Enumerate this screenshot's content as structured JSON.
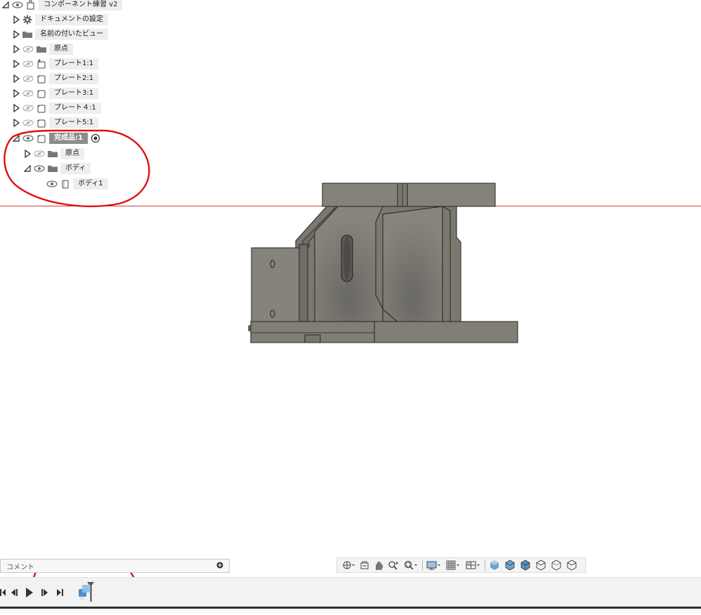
{
  "browser": {
    "root": {
      "label": "コンポーネント練習 v2"
    },
    "items": [
      {
        "label": "ドキュメントの設定",
        "icon": "gear-icon"
      },
      {
        "label": "名前の付いたビュー",
        "icon": "folder-icon"
      },
      {
        "label": "原点",
        "icon": "folder-icon"
      },
      {
        "label": "プレート1:1",
        "icon": "component-link-icon"
      },
      {
        "label": "プレート2:1",
        "icon": "component-icon"
      },
      {
        "label": "プレート3:1",
        "icon": "component-icon"
      },
      {
        "label": "プレート４:1",
        "icon": "component-icon"
      },
      {
        "label": "プレート5:1",
        "icon": "component-icon"
      },
      {
        "label": "完成品:1",
        "icon": "component-icon",
        "active": true
      },
      {
        "label": "原点",
        "icon": "folder-icon"
      },
      {
        "label": "ボディ",
        "icon": "folder-icon"
      },
      {
        "label": "ボディ1",
        "icon": "body-icon"
      }
    ]
  },
  "comment": {
    "placeholder": "コメント"
  },
  "colors": {
    "annotation": "#e01010",
    "ground_line": "#c83c3c",
    "model_fill": "#7d7b74",
    "model_dark": "#5f5d57",
    "model_light": "#8d8b84"
  },
  "navbar": {
    "icons": [
      "orbit-icon",
      "look-at-icon",
      "pan-icon",
      "zoom-icon",
      "fit-icon",
      "display-settings-icon",
      "grid-icon",
      "viewports-icon",
      "shaded-icon",
      "shaded-edges-icon",
      "shaded-hidden-edges-icon",
      "wireframe-icon",
      "wireframe-hidden-icon",
      "visible-edges-icon"
    ]
  },
  "timeline": {
    "controls": [
      "go-to-start-icon",
      "step-back-icon",
      "play-icon",
      "step-forward-icon",
      "go-to-end-icon"
    ],
    "features": [
      "component-feature-icon"
    ]
  }
}
